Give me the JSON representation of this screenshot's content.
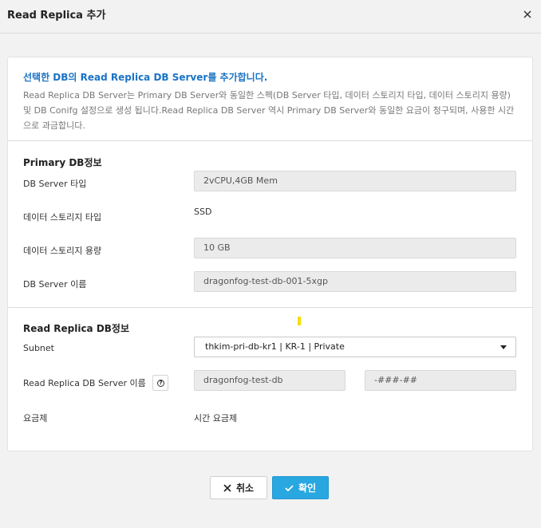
{
  "dialog": {
    "title": "Read Replica 추가",
    "close_icon": "close-icon"
  },
  "intro": {
    "heading": "선택한 DB의 Read Replica DB Server를 추가합니다.",
    "description": "Read Replica DB Server는 Primary DB Server와 동일한 스펙(DB Server 타입, 데이터 스토리지 타입, 데이터 스토리지 용량) 및 DB Conifg 설정으로 생성 됩니다.Read Replica DB Server 역시 Primary DB Server와 동일한 요금이 청구되며, 사용한 시간으로 과금합니다."
  },
  "primary": {
    "section_title": "Primary DB정보",
    "server_type_label": "DB Server 타입",
    "server_type_value": "2vCPU,4GB Mem",
    "storage_type_label": "데이터 스토리지 타입",
    "storage_type_value": "SSD",
    "storage_size_label": "데이터 스토리지 용량",
    "storage_size_value": "10 GB",
    "server_name_label": "DB Server 이름",
    "server_name_value": "dragonfog-test-db-001-5xgp"
  },
  "replica": {
    "section_title": "Read Replica DB정보",
    "subnet_label": "Subnet",
    "subnet_value": "thkim-pri-db-kr1 | KR-1 | Private",
    "server_name_label": "Read Replica DB Server 이름",
    "server_name_prefix": "dragonfog-test-db",
    "server_name_suffix": "-###-##",
    "pricing_label": "요금제",
    "pricing_value": "시간 요금제"
  },
  "footer": {
    "cancel_label": "취소",
    "confirm_label": "확인"
  },
  "colors": {
    "accent": "#29a7e1",
    "heading_blue": "#1a73c6"
  }
}
